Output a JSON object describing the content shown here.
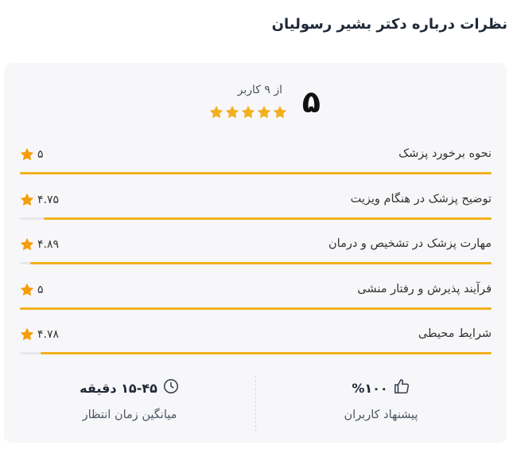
{
  "title": "نظرات درباره دکتر بشیر رسولیان",
  "summary": {
    "score": "۵",
    "of_users": "از ۹ کاربر",
    "stars": 5
  },
  "ratings": [
    {
      "label": "نحوه برخورد پزشک",
      "score": "۵",
      "value": 5
    },
    {
      "label": "توضیح پزشک در هنگام ویزیت",
      "score": "۴.۷۵",
      "value": 4.75
    },
    {
      "label": "مهارت پزشک در تشخیص و درمان",
      "score": "۴.۸۹",
      "value": 4.89
    },
    {
      "label": "فرآیند پذیرش و رفتار منشی",
      "score": "۵",
      "value": 5
    },
    {
      "label": "شرایط محیطی",
      "score": "۴.۷۸",
      "value": 4.78
    }
  ],
  "stats": {
    "recommend_value": "%۱۰۰",
    "recommend_label": "پیشنهاد کاربران",
    "wait_value": "۱۵-۴۵ دقیقه",
    "wait_label": "میانگین زمان انتظار"
  },
  "icons": {
    "star": "star-icon",
    "thumb": "thumbs-up-icon",
    "clock": "clock-icon"
  },
  "colors": {
    "star": "#f2b01e",
    "bar": "#f2b01e",
    "mini_star": "#f59e0b"
  }
}
